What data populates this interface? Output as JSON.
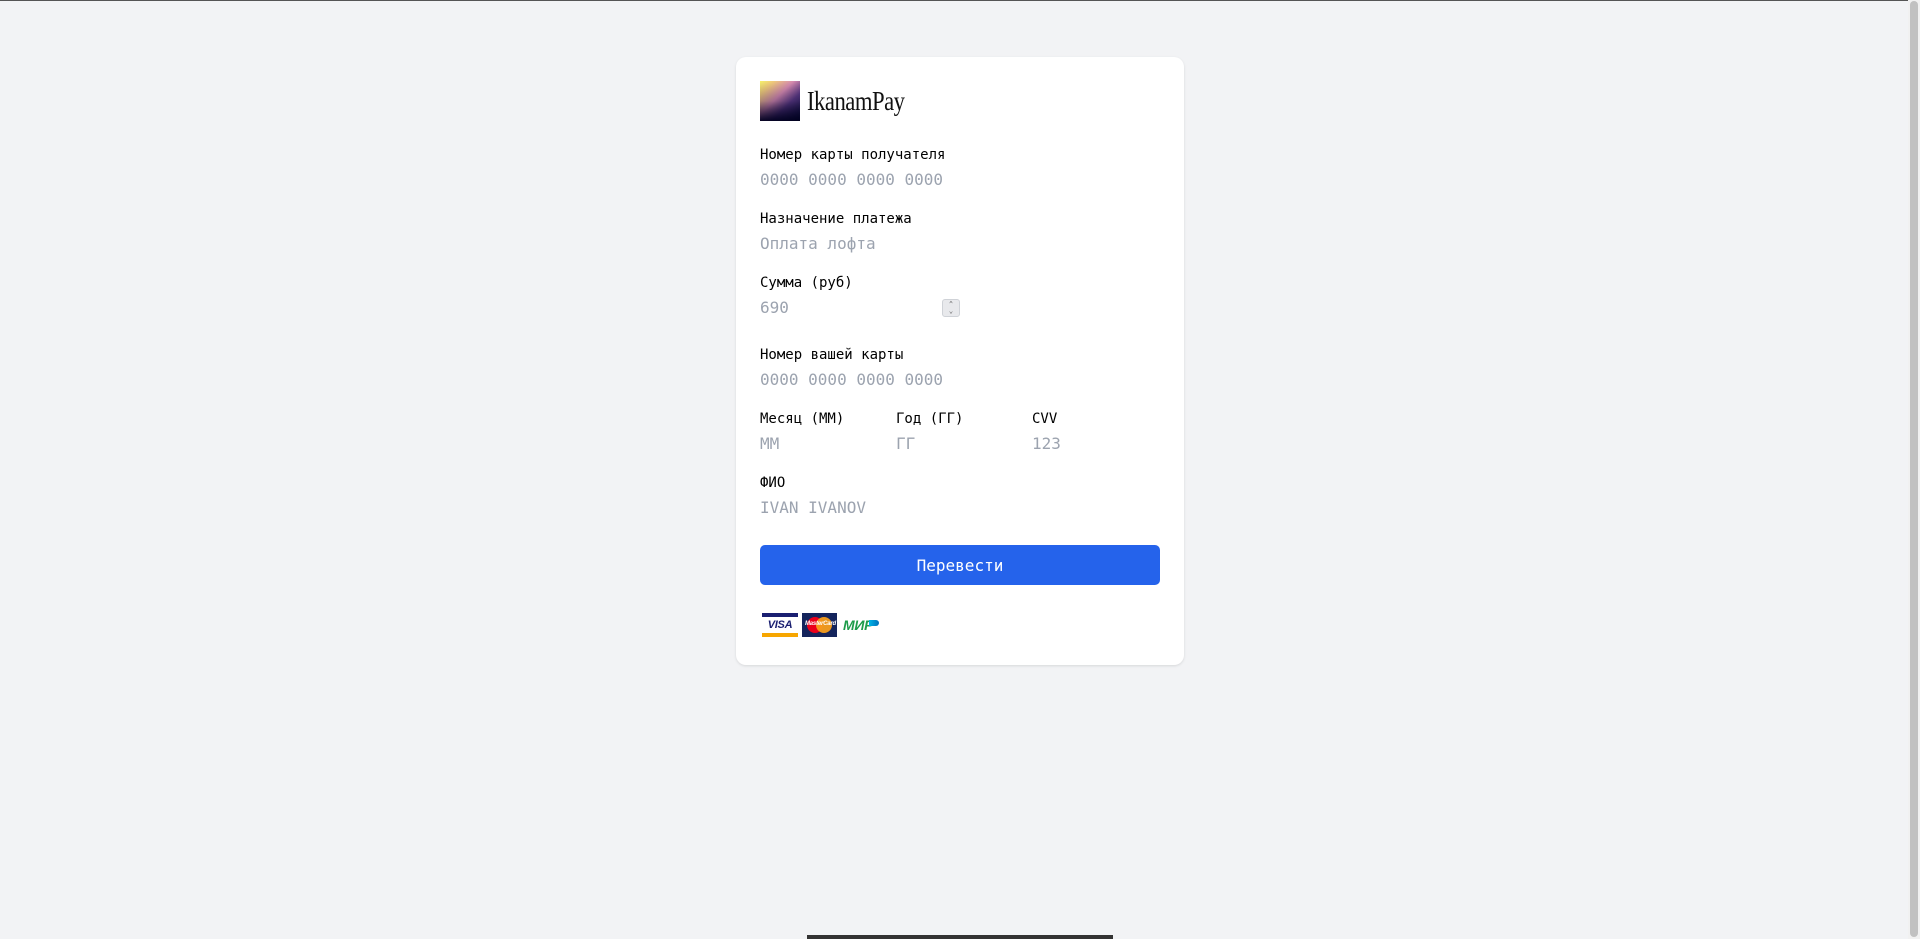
{
  "brand": {
    "name": "IkanamPay",
    "logo_icon": "ikanampay-gradient-logo"
  },
  "form": {
    "recipient_card": {
      "label": "Номер карты получателя",
      "placeholder": "0000 0000 0000 0000",
      "value": ""
    },
    "purpose": {
      "label": "Назначение платежа",
      "placeholder": "Оплата лофта",
      "value": ""
    },
    "amount": {
      "label": "Сумма (руб)",
      "placeholder": "690",
      "value": ""
    },
    "your_card": {
      "label": "Номер вашей карты",
      "placeholder": "0000 0000 0000 0000",
      "value": ""
    },
    "month": {
      "label": "Месяц (ММ)",
      "placeholder": "ММ",
      "value": ""
    },
    "year": {
      "label": "Год (ГГ)",
      "placeholder": "ГГ",
      "value": ""
    },
    "cvv": {
      "label": "CVV",
      "placeholder": "123",
      "value": ""
    },
    "name": {
      "label": "ФИО",
      "placeholder": "IVAN IVANOV",
      "value": ""
    },
    "submit_label": "Перевести"
  },
  "payment_systems": {
    "visa": {
      "text": "VISA",
      "icon": "visa-icon"
    },
    "mastercard": {
      "text": "MasterCard",
      "icon": "mastercard-icon"
    },
    "mir": {
      "text": "МИР",
      "icon": "mir-icon"
    }
  },
  "colors": {
    "page_bg": "#f2f3f5",
    "card_bg": "#ffffff",
    "accent": "#2563eb",
    "placeholder": "#9ca3af"
  }
}
